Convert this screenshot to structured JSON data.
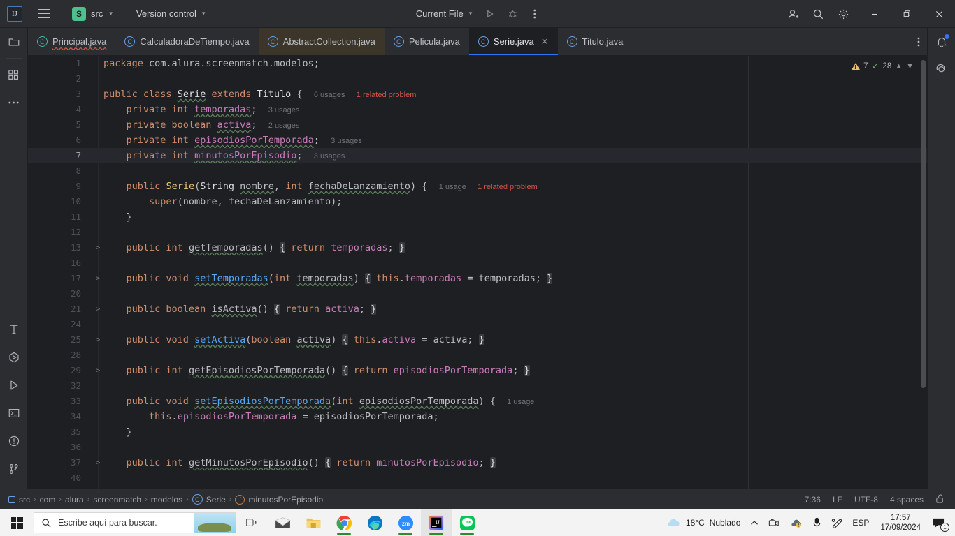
{
  "titlebar": {
    "logo": "ij-logo",
    "menu_icon": "hamburger-menu-icon",
    "project_badge": "S",
    "project_name": "src",
    "vcs_label": "Version control",
    "run_config": "Current File",
    "run_icon": "run-icon",
    "debug_icon": "debug-icon",
    "more_icon": "more-vertical-icon",
    "account_icon": "account-icon",
    "search_icon": "search-icon",
    "settings_icon": "settings-gear-icon",
    "minimize": "–",
    "maximize": "❐",
    "close": "✕"
  },
  "left_strip": {
    "top": [
      {
        "name": "project-tool-window",
        "icon": "folder-icon"
      },
      {
        "name": "structure-tool-window",
        "icon": "grid-squares-icon"
      },
      {
        "name": "more-tool-windows",
        "icon": "ellipsis-icon"
      }
    ],
    "bottom": [
      {
        "name": "build-tool-window",
        "icon": "hammer-icon"
      },
      {
        "name": "services-tool-window",
        "icon": "services-play-icon"
      },
      {
        "name": "run-tool-window",
        "icon": "play-triangle-icon"
      },
      {
        "name": "terminal-tool-window",
        "icon": "terminal-icon"
      },
      {
        "name": "problems-tool-window",
        "icon": "exclamation-circle-icon"
      },
      {
        "name": "git-tool-window",
        "icon": "git-branch-icon"
      }
    ]
  },
  "right_strip": [
    {
      "name": "notifications-tool-window",
      "icon": "bell-icon",
      "has_dot": true
    },
    {
      "name": "ai-assistant-tool-window",
      "icon": "spiral-icon",
      "has_dot": false
    }
  ],
  "tabs": [
    {
      "label": "Principal.java",
      "icon": "java-class-teal-icon",
      "state": "error",
      "active": false,
      "modified": false
    },
    {
      "label": "CalculadoraDeTiempo.java",
      "icon": "java-class-icon",
      "state": "normal",
      "active": false,
      "modified": false
    },
    {
      "label": "AbstractCollection.java",
      "icon": "java-class-icon",
      "state": "normal",
      "active": false,
      "modified": true
    },
    {
      "label": "Pelicula.java",
      "icon": "java-class-icon",
      "state": "normal",
      "active": false,
      "modified": false
    },
    {
      "label": "Serie.java",
      "icon": "java-class-icon",
      "state": "normal",
      "active": true,
      "modified": false
    },
    {
      "label": "Titulo.java",
      "icon": "java-class-icon",
      "state": "normal",
      "active": false,
      "modified": false
    }
  ],
  "tabs_more_icon": "tab-list-more-icon",
  "inspection": {
    "warning_count": "7",
    "ok_count": "28",
    "prev_icon": "chevron-up-icon",
    "next_icon": "chevron-down-icon"
  },
  "code": {
    "lines": [
      {
        "num": "1",
        "fold": "",
        "current": false
      },
      {
        "num": "2",
        "fold": "",
        "current": false
      },
      {
        "num": "3",
        "fold": "",
        "current": false
      },
      {
        "num": "4",
        "fold": "",
        "current": false
      },
      {
        "num": "5",
        "fold": "",
        "current": false
      },
      {
        "num": "6",
        "fold": "",
        "current": false
      },
      {
        "num": "7",
        "fold": "",
        "current": true
      },
      {
        "num": "8",
        "fold": "",
        "current": false
      },
      {
        "num": "9",
        "fold": "",
        "current": false
      },
      {
        "num": "10",
        "fold": "",
        "current": false
      },
      {
        "num": "11",
        "fold": "",
        "current": false
      },
      {
        "num": "12",
        "fold": "",
        "current": false
      },
      {
        "num": "13",
        "fold": ">",
        "current": false
      },
      {
        "num": "16",
        "fold": "",
        "current": false
      },
      {
        "num": "17",
        "fold": ">",
        "current": false
      },
      {
        "num": "20",
        "fold": "",
        "current": false
      },
      {
        "num": "21",
        "fold": ">",
        "current": false
      },
      {
        "num": "24",
        "fold": "",
        "current": false
      },
      {
        "num": "25",
        "fold": ">",
        "current": false
      },
      {
        "num": "28",
        "fold": "",
        "current": false
      },
      {
        "num": "29",
        "fold": ">",
        "current": false
      },
      {
        "num": "32",
        "fold": "",
        "current": false
      },
      {
        "num": "33",
        "fold": "",
        "current": false
      },
      {
        "num": "34",
        "fold": "",
        "current": false
      },
      {
        "num": "35",
        "fold": "",
        "current": false
      },
      {
        "num": "36",
        "fold": "",
        "current": false
      },
      {
        "num": "37",
        "fold": ">",
        "current": false
      },
      {
        "num": "40",
        "fold": "",
        "current": false
      }
    ],
    "text_lines": [
      "package com.alura.screenmatch.modelos;",
      "",
      "public class Serie extends Titulo {",
      "    private int temporadas;",
      "    private boolean activa;",
      "    private int episodiosPorTemporada;",
      "    private int minutosPorEpisodio;",
      "",
      "    public Serie(String nombre, int fechaDeLanzamiento) {",
      "        super(nombre, fechaDeLanzamiento);",
      "    }",
      "",
      "    public int getTemporadas() { return temporadas; }",
      "",
      "    public void setTemporadas(int temporadas) { this.temporadas = temporadas; }",
      "",
      "    public boolean isActiva() { return activa; }",
      "",
      "    public void setActiva(boolean activa) { this.activa = activa; }",
      "",
      "    public int getEpisodiosPorTemporada() { return episodiosPorTemporada; }",
      "",
      "    public void setEpisodiosPorTemporada(int episodiosPorTemporada) {",
      "        this.episodiosPorTemporada = episodiosPorTemporada;",
      "    }",
      "",
      "    public int getMinutosPorEpisodio() { return minutosPorEpisodio; }",
      ""
    ],
    "hints": {
      "class_usages": "6 usages",
      "class_problem": "1 related problem",
      "temporadas_usages": "3 usages",
      "activa_usages": "2 usages",
      "episodios_usages": "3 usages",
      "minutos_usages": "3 usages",
      "ctor_usages": "1 usage",
      "ctor_problem": "1 related problem",
      "setter_usages": "1 usage"
    }
  },
  "statusbar": {
    "breadcrumbs": [
      {
        "label": "src",
        "icon": "module-icon"
      },
      {
        "label": "com",
        "icon": ""
      },
      {
        "label": "alura",
        "icon": ""
      },
      {
        "label": "screenmatch",
        "icon": ""
      },
      {
        "label": "modelos",
        "icon": ""
      },
      {
        "label": "Serie",
        "icon": "java-class-icon"
      },
      {
        "label": "minutosPorEpisodio",
        "icon": "field-icon"
      }
    ],
    "separator": "›",
    "caret": "7:36",
    "line_separator": "LF",
    "encoding": "UTF-8",
    "indent": "4 spaces",
    "lock_icon": "unlocked-padlock-icon"
  },
  "taskbar": {
    "start_icon": "windows-start-icon",
    "search_icon": "search-icon",
    "search_placeholder": "Escribe aquí para buscar.",
    "apps": [
      {
        "name": "task-view-button",
        "icon": "task-view-icon",
        "running": false,
        "active": false
      },
      {
        "name": "mail-app",
        "icon": "mail-envelope-icon",
        "running": false,
        "active": false
      },
      {
        "name": "file-explorer-app",
        "icon": "folder-icon",
        "running": false,
        "active": false
      },
      {
        "name": "chrome-app",
        "icon": "chrome-icon",
        "running": true,
        "active": false
      },
      {
        "name": "edge-app",
        "icon": "edge-icon",
        "running": false,
        "active": false
      },
      {
        "name": "zoom-app",
        "icon": "zoom-icon",
        "running": true,
        "active": false
      },
      {
        "name": "intellij-app",
        "icon": "intellij-icon",
        "running": true,
        "active": true
      },
      {
        "name": "line-app",
        "icon": "line-icon",
        "running": true,
        "active": false
      }
    ],
    "weather_temp": "18°C",
    "weather_desc": "Nublado",
    "tray": [
      {
        "name": "show-hidden-icons",
        "icon": "chevron-up-icon"
      },
      {
        "name": "camera-tray-icon",
        "icon": "camera-icon"
      },
      {
        "name": "onedrive-tray-icon",
        "icon": "cloud-warning-icon"
      },
      {
        "name": "microphone-tray-icon",
        "icon": "microphone-icon"
      },
      {
        "name": "pen-tray-icon",
        "icon": "pen-icon"
      }
    ],
    "language": "ESP",
    "time": "17:57",
    "date": "17/09/2024",
    "notification_icon": "notification-chat-icon",
    "notification_count": "1"
  },
  "colors": {
    "accent": "#3574f0",
    "keyword": "#cf8e6d",
    "field": "#c77dbb",
    "method": "#56a8f5",
    "warning": "#e8bf6a",
    "error": "#d1544a",
    "ok": "#5fad65"
  }
}
